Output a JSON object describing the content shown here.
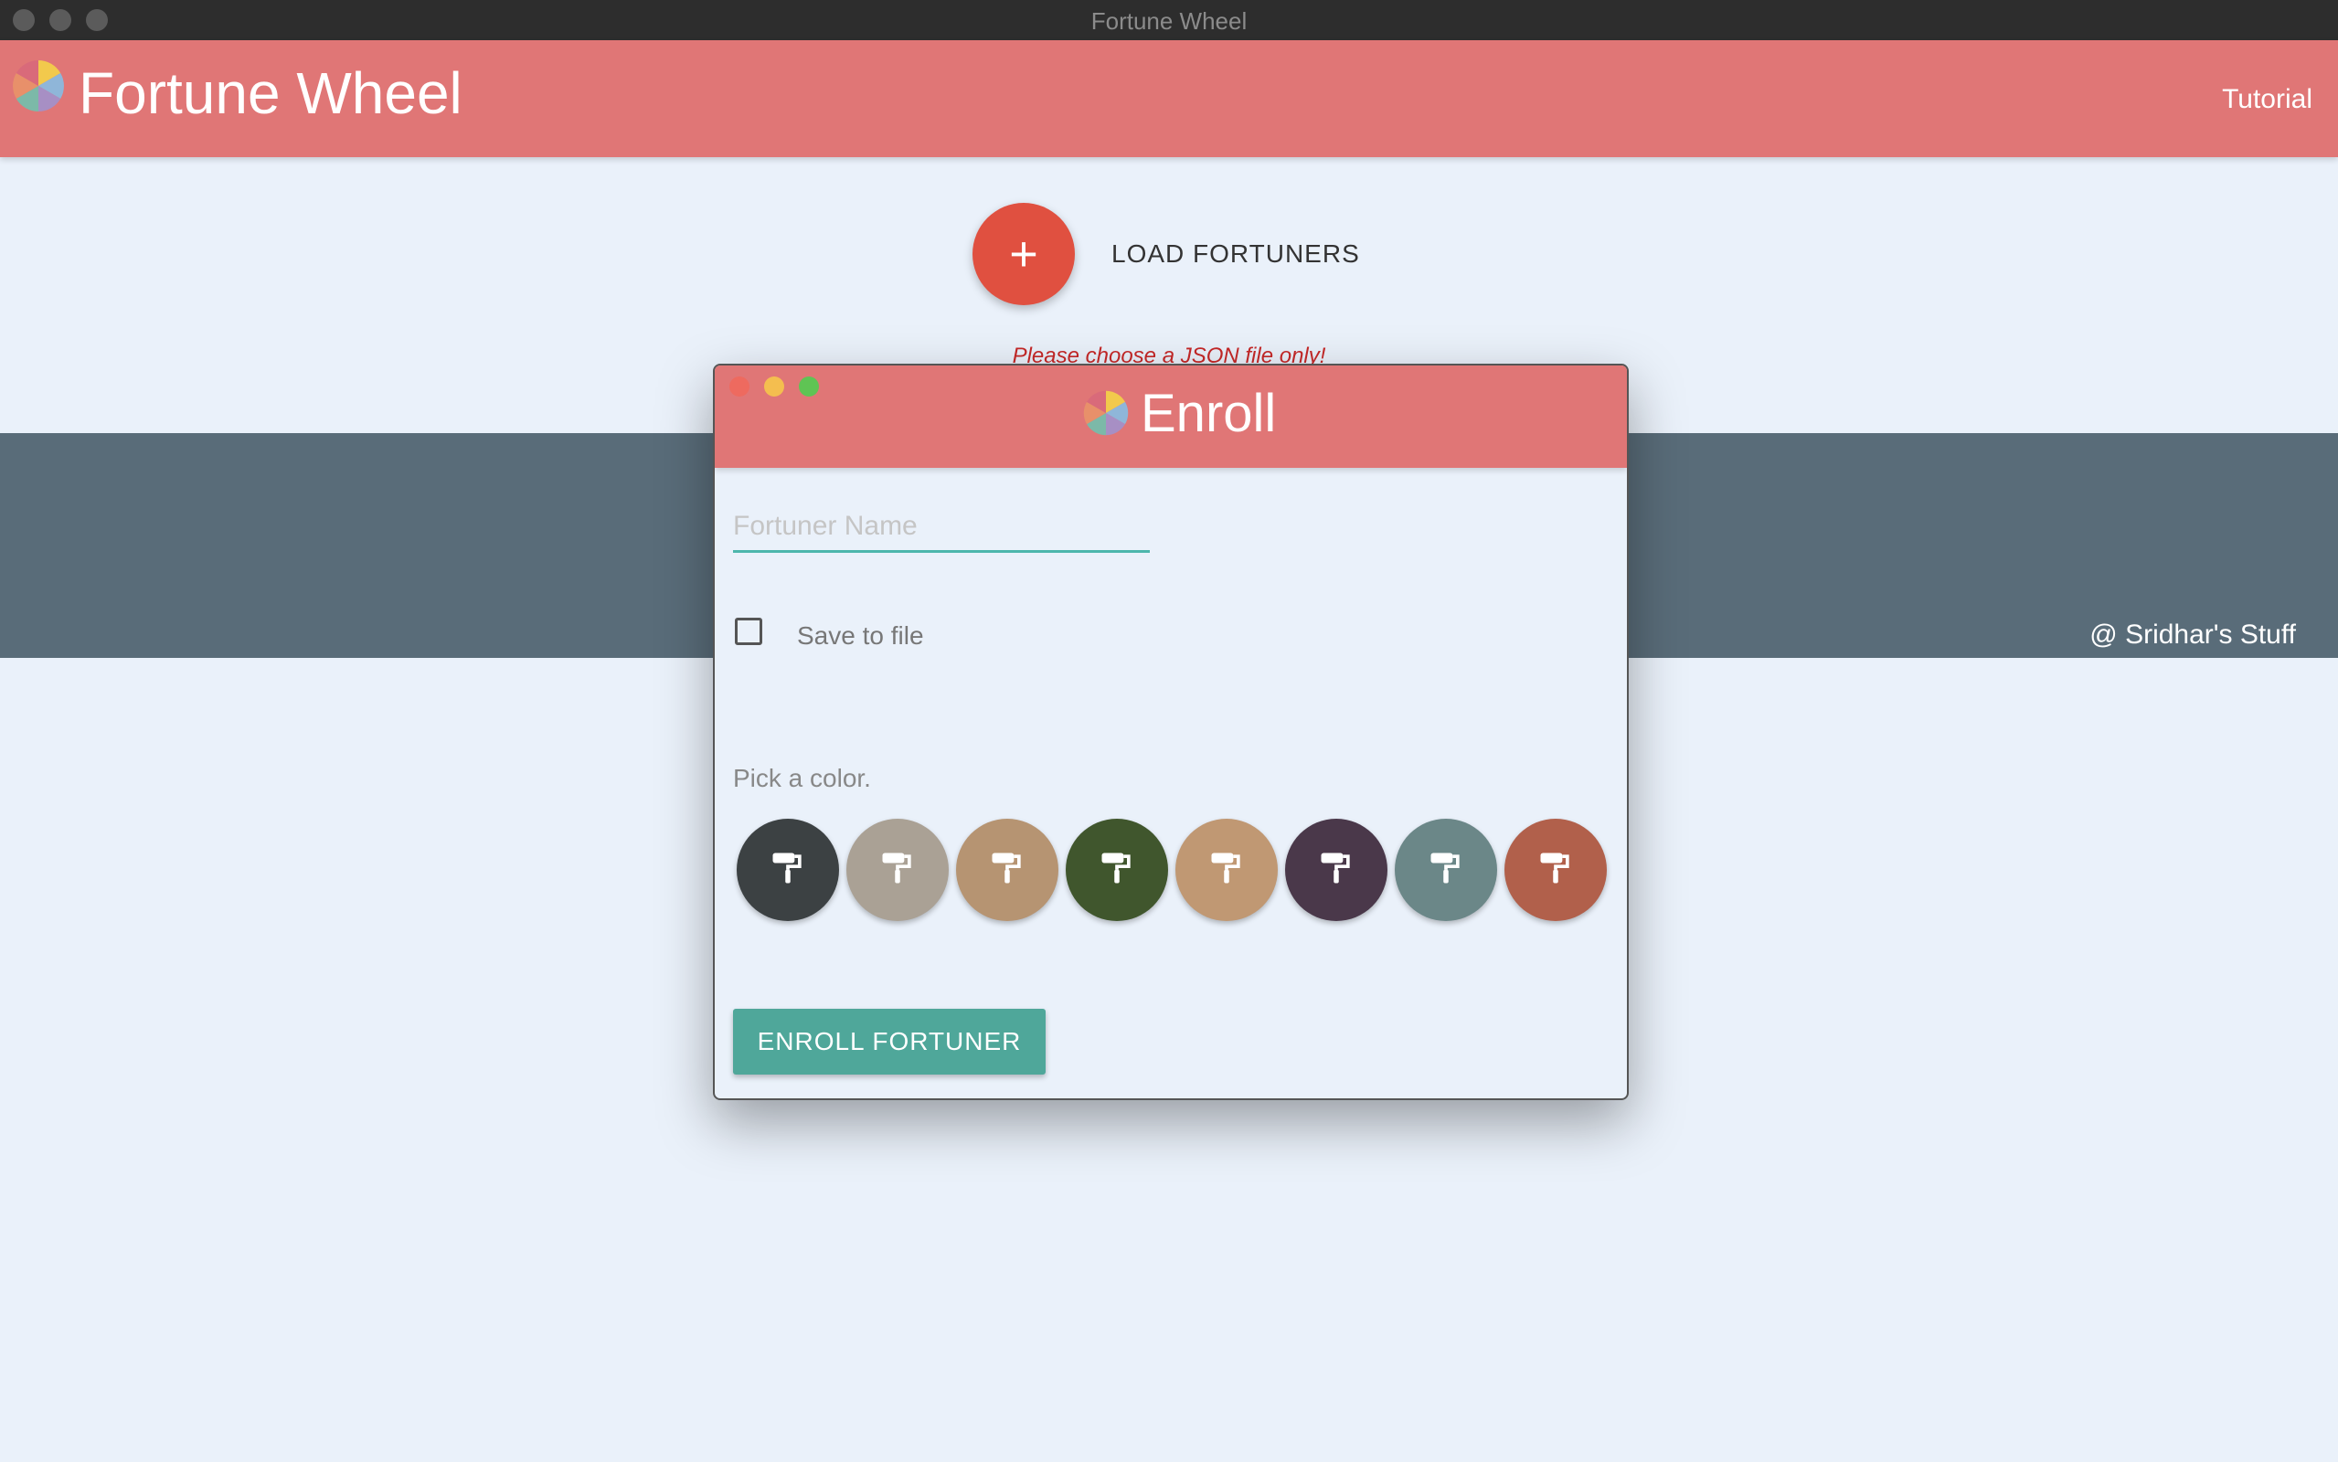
{
  "window": {
    "title": "Fortune Wheel"
  },
  "header": {
    "title": "Fortune Wheel",
    "tutorial_link": "Tutorial"
  },
  "load": {
    "button_icon": "+",
    "label": "LOAD FORTUNERS",
    "hint": "Please choose a JSON file only!"
  },
  "footer": {
    "credit": "@ Sridhar's Stuff"
  },
  "modal": {
    "title": "Enroll",
    "name_placeholder": "Fortuner Name",
    "name_value": "",
    "save_to_file_label": "Save to file",
    "save_to_file_checked": false,
    "pick_color_label": "Pick a color.",
    "swatches": [
      "#3c4143",
      "#aaa195",
      "#b69472",
      "#40562d",
      "#c09873",
      "#4a384a",
      "#6b8788",
      "#b1604b"
    ],
    "submit_label": "ENROLL FORTUNER"
  },
  "colors": {
    "header": "#e07676",
    "background": "#eaf1fa",
    "band": "#596c79",
    "fab": "#e05040",
    "accent": "#4fa79a",
    "error": "#c62828"
  },
  "icons": [
    "color-wheel-icon",
    "plus-icon",
    "paint-roller-icon"
  ]
}
